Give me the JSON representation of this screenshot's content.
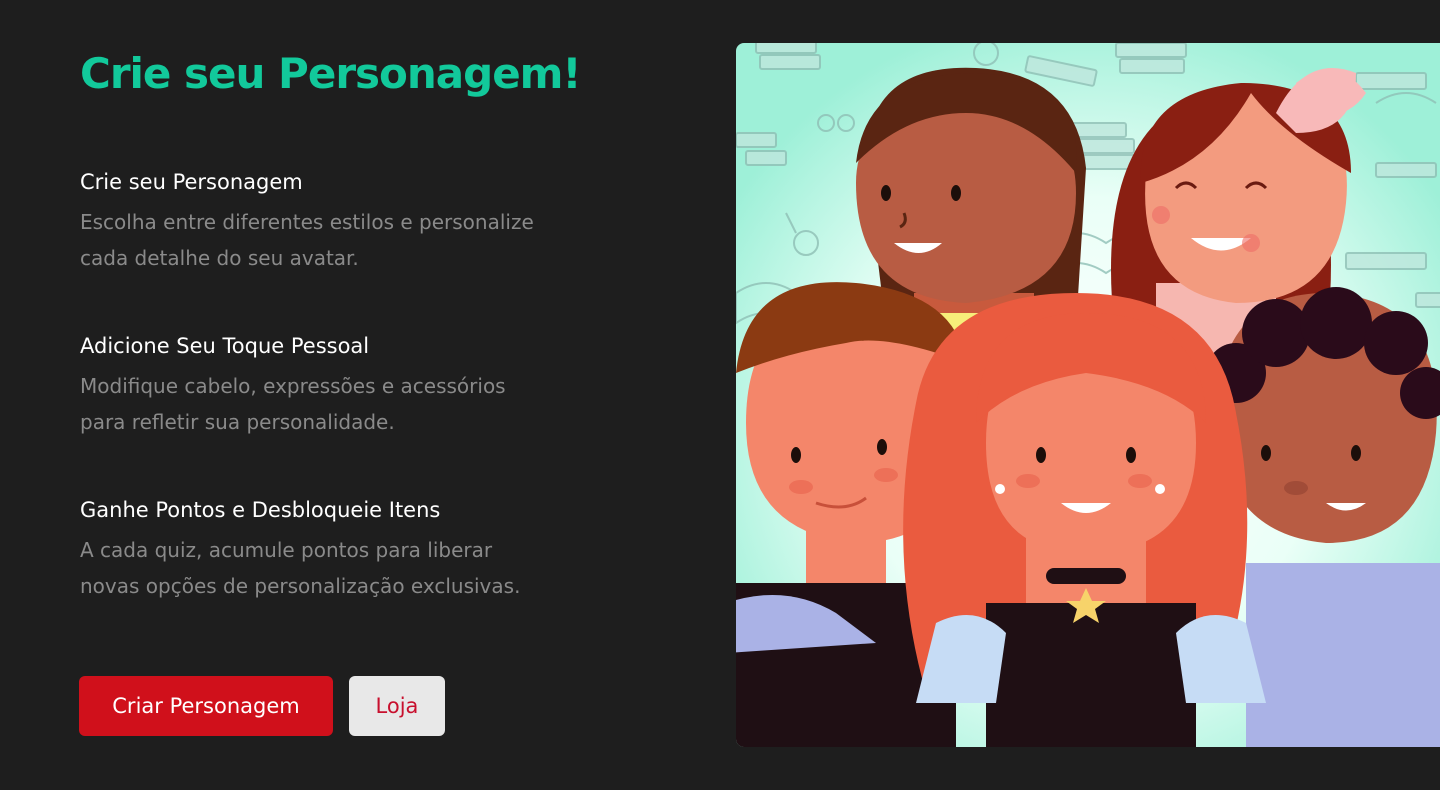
{
  "hero": {
    "title": "Crie seu Personagem!"
  },
  "features": [
    {
      "heading": "Crie seu Personagem",
      "line1": "Escolha entre diferentes estilos e personalize",
      "line2": "cada detalhe do seu avatar."
    },
    {
      "heading": "Adicione Seu Toque Pessoal",
      "line1": "Modifique cabelo, expressões e acessórios",
      "line2": "para refletir sua personalidade."
    },
    {
      "heading": "Ganhe Pontos e Desbloqueie Itens",
      "line1": "A cada quiz, acumule pontos para liberar",
      "line2": "novas opções de personalização exclusivas."
    }
  ],
  "actions": {
    "primary_label": "Criar Personagem",
    "secondary_label": "Loja"
  },
  "colors": {
    "background": "#1e1e1e",
    "accent": "#12c99b",
    "primary_button": "#d0101b",
    "secondary_button": "#e8e8e8"
  }
}
